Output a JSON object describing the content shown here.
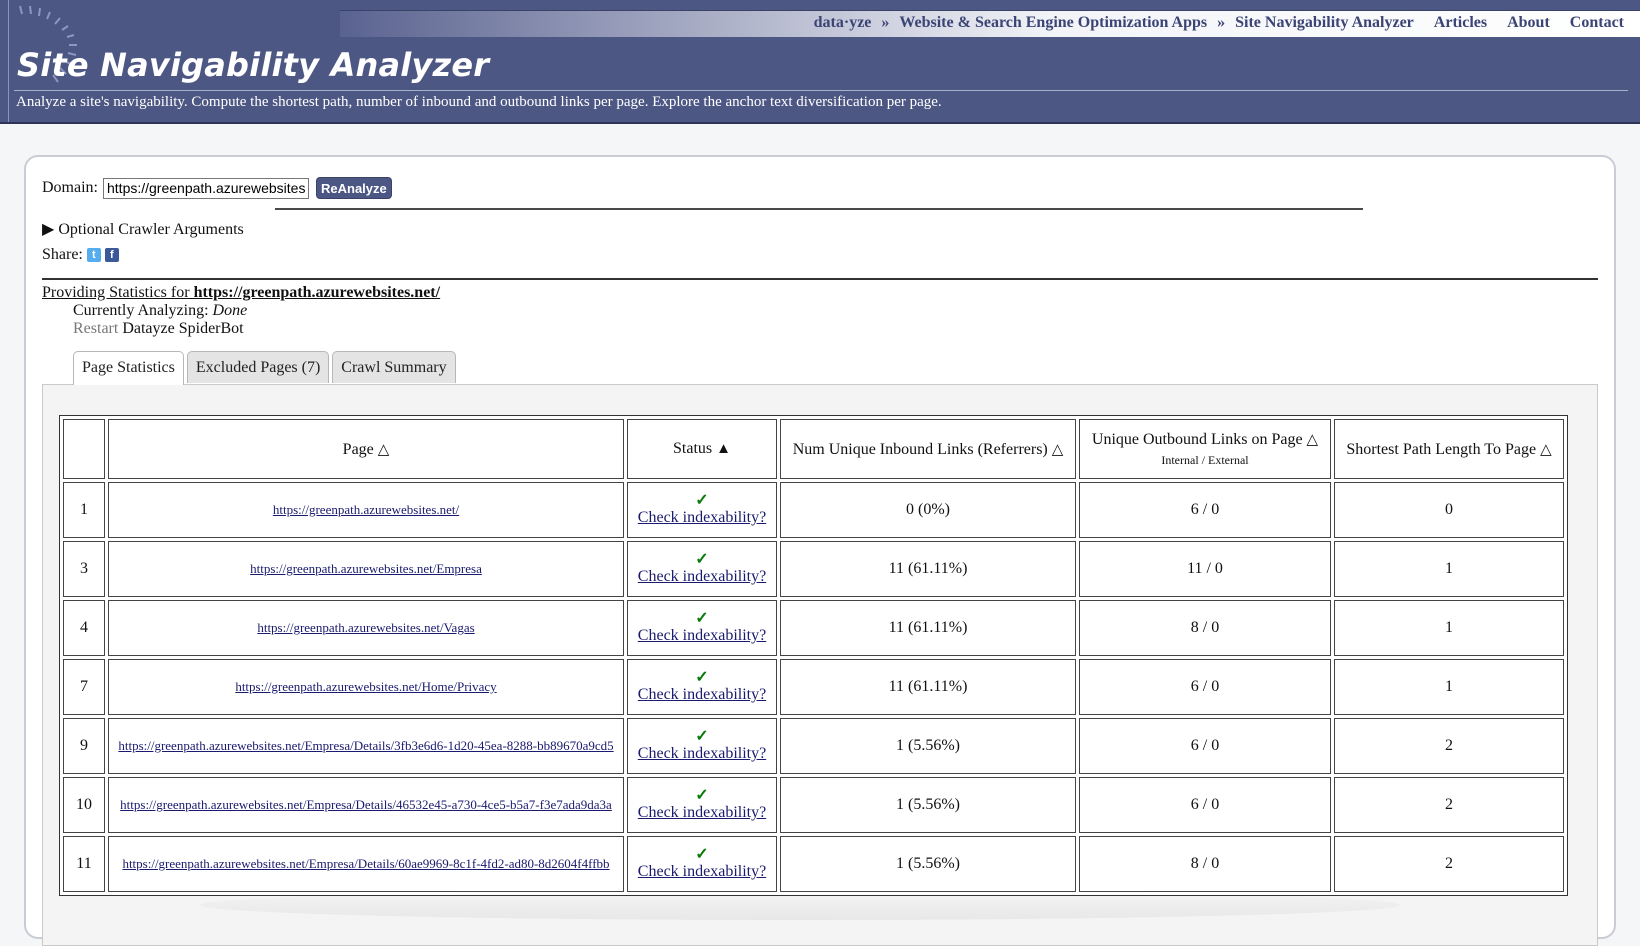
{
  "nav": {
    "items": [
      "data·yze",
      "Website & Search Engine Optimization Apps",
      "Site Navigability Analyzer"
    ],
    "separator": "»",
    "links": [
      "Articles",
      "About",
      "Contact"
    ]
  },
  "header": {
    "title": "Site Navigability Analyzer",
    "tagline": "Analyze a site's navigability. Compute the shortest path, number of inbound and outbound links per page. Explore the anchor text diversification per page."
  },
  "form": {
    "domain_label": "Domain:",
    "domain_value": "https://greenpath.azurewebsites.net/",
    "button_label": "ReAnalyze",
    "optional_args": "Optional Crawler Arguments",
    "optional_args_icon": "triangle-right-icon",
    "share_label": "Share:"
  },
  "status": {
    "providing_prefix": "Providing Statistics for ",
    "providing_url": "https://greenpath.azurewebsites.net/",
    "analyzing_label": "Currently Analyzing:",
    "analyzing_value": "Done",
    "restart_link": "Restart",
    "restart_suffix": "Datayze SpiderBot"
  },
  "tabs": [
    "Page Statistics",
    "Excluded Pages (7)",
    "Crawl Summary"
  ],
  "active_tab": "Page Statistics",
  "table": {
    "headers": {
      "page": "Page",
      "status": "Status",
      "inbound": "Num Unique Inbound Links (Referrers)",
      "outbound": "Unique Outbound Links on Page",
      "outbound_sub": "Internal / External",
      "shortest": "Shortest Path Length To Page"
    },
    "sort_icons": {
      "unsorted": "△",
      "sorted_asc": "▲"
    },
    "check_symbol": "✓",
    "check_label": "Check indexability?",
    "rows": [
      {
        "idx": "1",
        "page": "https://greenpath.azurewebsites.net/",
        "inbound": "0 (0%)",
        "outbound": "6 / 0",
        "shortest": "0"
      },
      {
        "idx": "3",
        "page": "https://greenpath.azurewebsites.net/Empresa",
        "inbound": "11 (61.11%)",
        "outbound": "11 / 0",
        "shortest": "1"
      },
      {
        "idx": "4",
        "page": "https://greenpath.azurewebsites.net/Vagas",
        "inbound": "11 (61.11%)",
        "outbound": "8 / 0",
        "shortest": "1"
      },
      {
        "idx": "7",
        "page": "https://greenpath.azurewebsites.net/Home/Privacy",
        "inbound": "11 (61.11%)",
        "outbound": "6 / 0",
        "shortest": "1"
      },
      {
        "idx": "9",
        "page": "https://greenpath.azurewebsites.net/Empresa/Details/3fb3e6d6-1d20-45ea-8288-bb89670a9cd5",
        "inbound": "1 (5.56%)",
        "outbound": "6 / 0",
        "shortest": "2"
      },
      {
        "idx": "10",
        "page": "https://greenpath.azurewebsites.net/Empresa/Details/46532e45-a730-4ce5-b5a7-f3e7ada9da3a",
        "inbound": "1 (5.56%)",
        "outbound": "6 / 0",
        "shortest": "2"
      },
      {
        "idx": "11",
        "page": "https://greenpath.azurewebsites.net/Empresa/Details/60ae9969-8c1f-4fd2-ad80-8d2604f4ffbb",
        "inbound": "1 (5.56%)",
        "outbound": "8 / 0",
        "shortest": "2"
      }
    ]
  }
}
